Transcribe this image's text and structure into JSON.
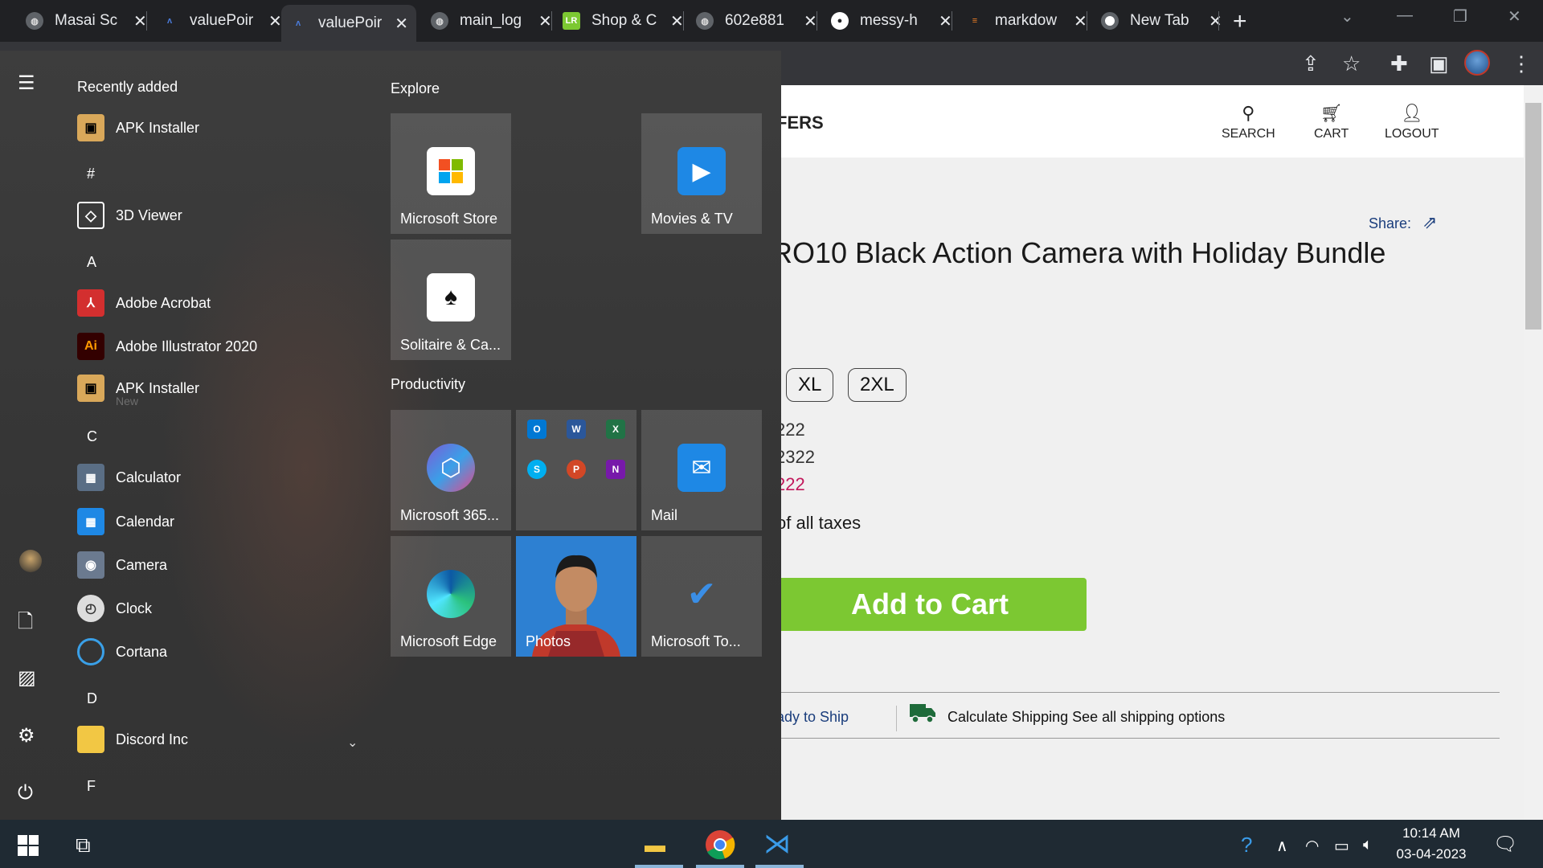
{
  "browser": {
    "tabs": [
      {
        "title": "Masai Sc",
        "favicon": "globe-icon",
        "active": false
      },
      {
        "title": "valuePoir",
        "favicon": "valuepoint-icon",
        "active": false
      },
      {
        "title": "valuePoir",
        "favicon": "valuepoint-icon",
        "active": true
      },
      {
        "title": "main_log",
        "favicon": "globe-icon",
        "active": false
      },
      {
        "title": "Shop & C",
        "favicon": "lr-icon",
        "active": false
      },
      {
        "title": "602e881",
        "favicon": "globe-icon",
        "active": false
      },
      {
        "title": "messy-h",
        "favicon": "github-icon",
        "active": false
      },
      {
        "title": "markdow",
        "favicon": "stackoverflow-icon",
        "active": false
      },
      {
        "title": "New Tab",
        "favicon": "chrome-icon",
        "active": false
      }
    ]
  },
  "site": {
    "brand_partial": "FERS",
    "nav": {
      "search": "SEARCH",
      "cart": "CART",
      "logout": "LOGOUT"
    },
    "share_label": "Share:",
    "product_title": "RO10 Black Action Camera with Holiday Bundle",
    "sizes": [
      "XL",
      "2XL"
    ],
    "prices": [
      "222",
      "2322",
      "222"
    ],
    "taxes_note": "of all taxes",
    "add_to_cart": "Add to Cart",
    "ready_to_ship": "ady to Ship",
    "shipping": "Calculate Shipping See all shipping options"
  },
  "start_menu": {
    "recently_added": "Recently added",
    "letters": {
      "hash": "#",
      "a": "A",
      "c": "C",
      "d": "D",
      "f": "F"
    },
    "apps": {
      "apk_installer": "APK Installer",
      "viewer_3d": "3D Viewer",
      "adobe_acrobat": "Adobe Acrobat",
      "adobe_illustrator": "Adobe Illustrator 2020",
      "apk_installer_2": "APK Installer",
      "apk_new": "New",
      "calculator": "Calculator",
      "calendar": "Calendar",
      "camera": "Camera",
      "clock": "Clock",
      "cortana": "Cortana",
      "discord": "Discord Inc"
    },
    "explore": "Explore",
    "productivity": "Productivity",
    "tiles": {
      "store": "Microsoft Store",
      "movies": "Movies & TV",
      "solitaire": "Solitaire & Ca...",
      "m365": "Microsoft 365...",
      "mail": "Mail",
      "edge": "Microsoft Edge",
      "photos": "Photos",
      "todo": "Microsoft To..."
    }
  },
  "taskbar": {
    "time": "10:14 AM",
    "date": "03-04-2023"
  },
  "colors": {
    "add_to_cart_green": "#7cc832",
    "price_red": "#c2185b",
    "link_blue": "#1a3d7c",
    "taskbar": "#1f2a33"
  }
}
